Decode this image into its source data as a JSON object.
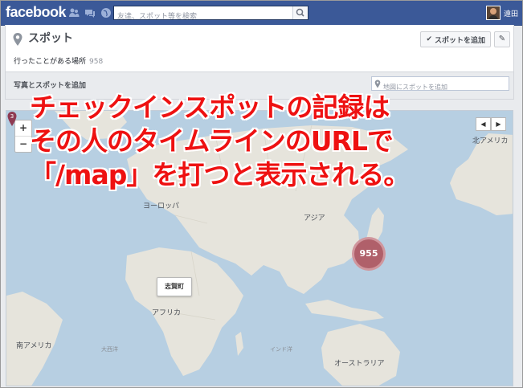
{
  "app": {
    "logo": "facebook",
    "search_placeholder": "友達、スポット等を検索",
    "user_name": "遠田"
  },
  "header": {
    "title": "スポット",
    "visited_label": "行ったことがある場所",
    "visited_count": "958",
    "add_spot_button": "スポットを追加"
  },
  "addbar": {
    "label": "写真とスポットを追加",
    "map_search_placeholder": "地図にスポットを追加"
  },
  "map": {
    "zoom_in": "+",
    "zoom_out": "−",
    "pager_prev": "◀",
    "pager_next": "▶",
    "labels": {
      "europe": "ヨーロッパ",
      "asia": "アジア",
      "africa": "アフリカ",
      "south_america": "南アメリカ",
      "oceania": "オーストラリア",
      "north_america": "北アメリカ",
      "atlantic": "大西洋",
      "indian": "インド洋"
    },
    "cluster_count": "955",
    "marker_count": "3",
    "marker_place": "志賀町"
  },
  "overlay": {
    "line1": "チェックインスポットの記録は",
    "line2": "その人のタイムラインのURLで",
    "line3": "「/map」を打つと表示される。"
  },
  "colors": {
    "facebook_blue": "#3b5998",
    "annotation_red": "#ee1111",
    "cluster": "#b0606a",
    "ocean": "#b7cfe2",
    "land": "#e6e4dc"
  }
}
